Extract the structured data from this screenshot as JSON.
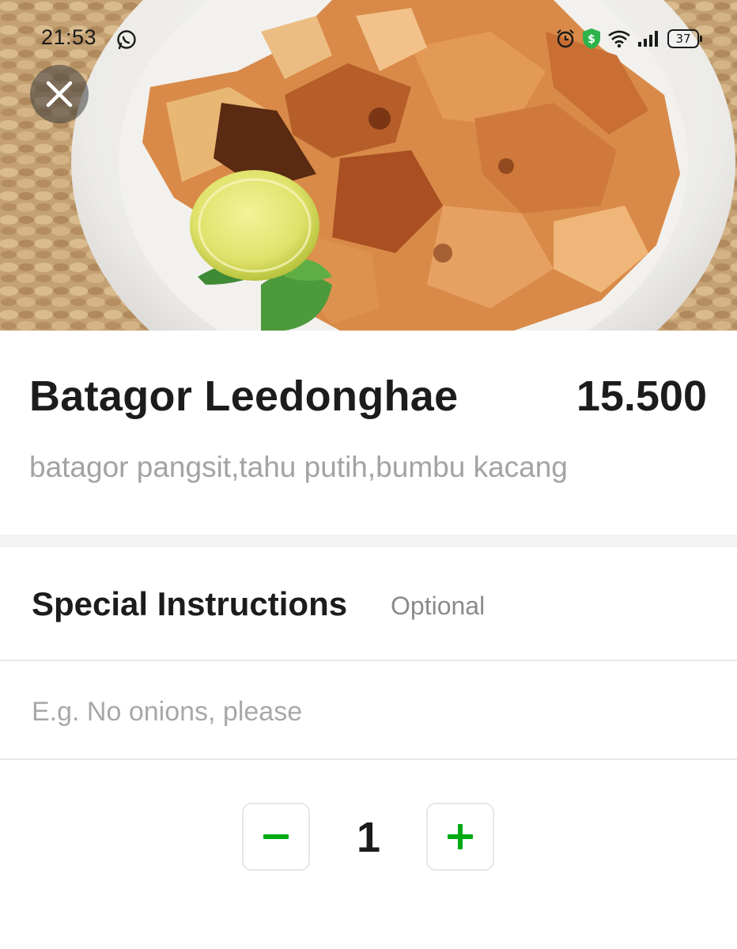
{
  "status_bar": {
    "time": "21:53",
    "battery_level": "37",
    "icons": [
      "whatsapp-icon",
      "alarm-icon",
      "shield-dollar-icon",
      "wifi-icon",
      "signal-icon",
      "battery-icon"
    ]
  },
  "hero": {
    "icon_close": "close-icon"
  },
  "item": {
    "name": "Batagor Leedonghae",
    "price": "15.500",
    "description": "batagor pangsit,tahu putih,bumbu kacang"
  },
  "instructions": {
    "title": "Special Instructions",
    "optional_label": "Optional",
    "placeholder": "E.g. No onions, please",
    "value": ""
  },
  "quantity": {
    "value": "1",
    "minus_icon": "minus-icon",
    "plus_icon": "plus-icon"
  },
  "colors": {
    "accent": "#00aa13",
    "text_primary": "#1c1c1c",
    "text_secondary": "#a3a3a3",
    "divider": "#e8e8e8"
  }
}
